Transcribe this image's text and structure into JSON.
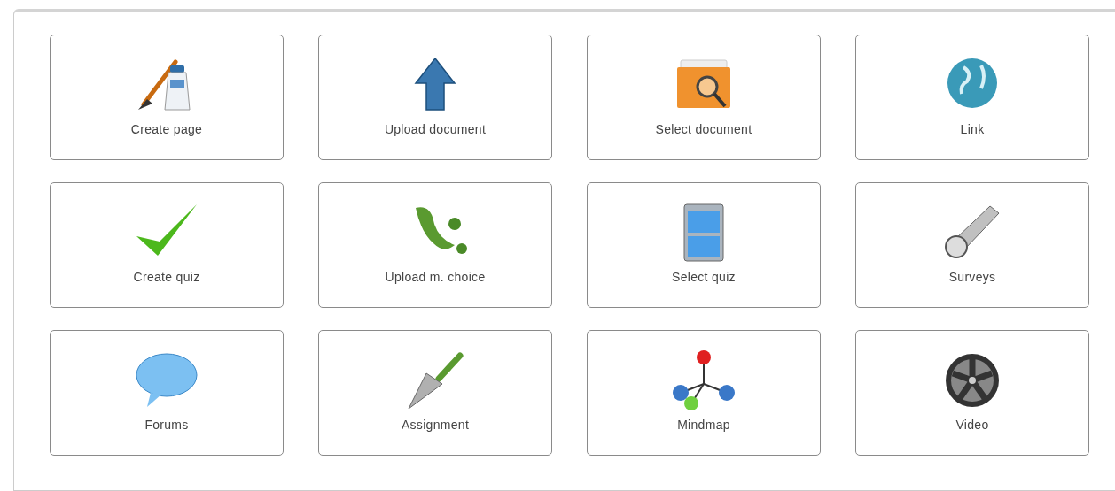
{
  "tools": [
    {
      "label": "Create page",
      "kind": "paint"
    },
    {
      "label": "Upload document",
      "kind": "upload"
    },
    {
      "label": "Select document",
      "kind": "folder"
    },
    {
      "label": "Link",
      "kind": "globe"
    },
    {
      "label": "Create quiz",
      "kind": "check"
    },
    {
      "label": "Upload m. choice",
      "kind": "blob"
    },
    {
      "label": "Select quiz",
      "kind": "cabinet"
    },
    {
      "label": "Surveys",
      "kind": "flashlight"
    },
    {
      "label": "Forums",
      "kind": "bubble"
    },
    {
      "label": "Assignment",
      "kind": "trowel"
    },
    {
      "label": "Mindmap",
      "kind": "mindmap"
    },
    {
      "label": "Video",
      "kind": "reel"
    }
  ]
}
